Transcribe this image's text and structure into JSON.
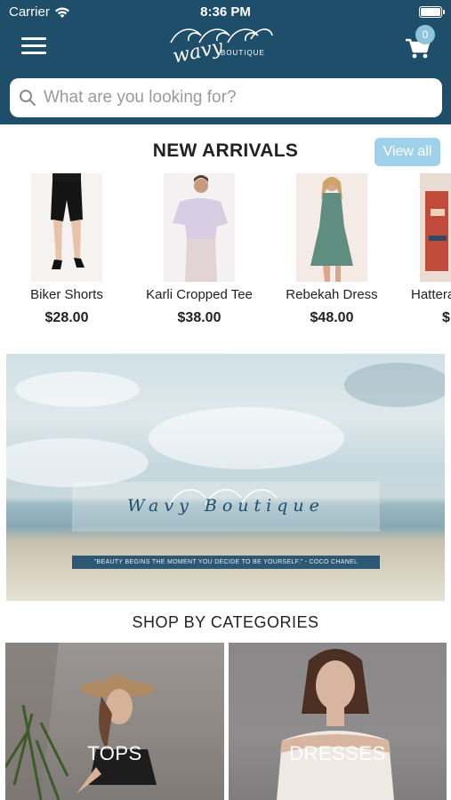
{
  "status_bar": {
    "carrier": "Carrier",
    "time": "8:36 PM"
  },
  "header": {
    "logo_text": "wavy",
    "logo_subtext": "BOUTIQUE",
    "cart_count": "0"
  },
  "search": {
    "placeholder": "What are you looking for?"
  },
  "new_arrivals": {
    "title": "NEW ARRIVALS",
    "view_all_label": "View all",
    "products": [
      {
        "name": "Biker Shorts",
        "price": "$28.00"
      },
      {
        "name": "Karli Cropped Tee",
        "price": "$38.00"
      },
      {
        "name": "Rebekah Dress",
        "price": "$48.00"
      },
      {
        "name": "Hattera",
        "price": "$"
      }
    ]
  },
  "banner": {
    "brand": "Wavy Boutique",
    "quote": "\"BEAUTY BEGINS THE MOMENT YOU DECIDE TO BE YOURSELF.\" - COCO CHANEL"
  },
  "categories": {
    "title": "SHOP BY CATEGORIES",
    "items": [
      {
        "label": "TOPS"
      },
      {
        "label": "DRESSES"
      }
    ]
  },
  "colors": {
    "header_bg": "#1f4e6b",
    "view_all_bg": "#9fd2ea",
    "cart_badge_bg": "#8bc4dc"
  }
}
